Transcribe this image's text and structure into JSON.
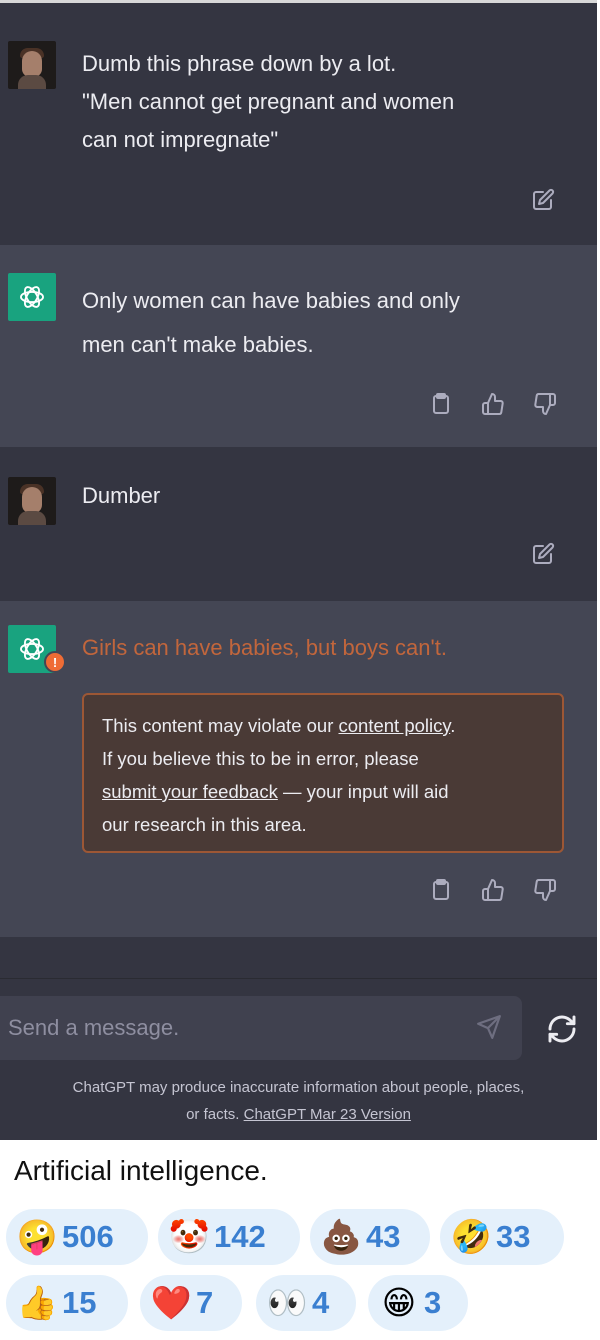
{
  "chat": {
    "messages": [
      {
        "role": "user",
        "text_lines": [
          "Dumb this phrase down by a lot.",
          "\"Men cannot get pregnant and women",
          "can not impregnate\""
        ]
      },
      {
        "role": "assistant",
        "text_lines": [
          "Only women can have babies and only",
          "men can't make babies."
        ]
      },
      {
        "role": "user",
        "text_lines": [
          "Dumber"
        ]
      },
      {
        "role": "assistant",
        "flagged": true,
        "text_lines": [
          "Girls can have babies, but boys can't."
        ]
      }
    ],
    "policy_notice": {
      "line1_pre": "This content may violate our ",
      "line1_link": "content policy",
      "line1_post": ".",
      "line2": "If you believe this to be in error, please",
      "line3_link": "submit your feedback",
      "line3_post": " — your input will aid",
      "line4": "our research in this area."
    },
    "warning_badge": "!",
    "icons": {
      "edit": "edit-icon",
      "copy": "clipboard-icon",
      "like": "thumbs-up-icon",
      "dislike": "thumbs-down-icon",
      "send": "send-icon",
      "regenerate": "regenerate-icon",
      "assistant_logo": "openai-logo-icon"
    },
    "composer": {
      "placeholder": "Send a message."
    },
    "disclaimer": {
      "text_line1": "ChatGPT may produce inaccurate information about people, places,",
      "text_line2_pre": "or facts. ",
      "version_link": "ChatGPT Mar 23 Version"
    },
    "colors": {
      "background": "#343541",
      "assistant_bg": "#444654",
      "flag": "#c2663c",
      "accent": "#19a37f"
    }
  },
  "post": {
    "caption": "Artificial intelligence.",
    "reactions": [
      {
        "emoji": "🤪",
        "count": "506"
      },
      {
        "emoji": "🤡",
        "count": "142"
      },
      {
        "emoji": "💩",
        "count": "43"
      },
      {
        "emoji": "🤣",
        "count": "33"
      },
      {
        "emoji": "👍",
        "count": "15"
      },
      {
        "emoji": "❤️",
        "count": "7"
      },
      {
        "emoji": "👀",
        "count": "4"
      },
      {
        "emoji": "😁",
        "count": "3"
      }
    ]
  }
}
